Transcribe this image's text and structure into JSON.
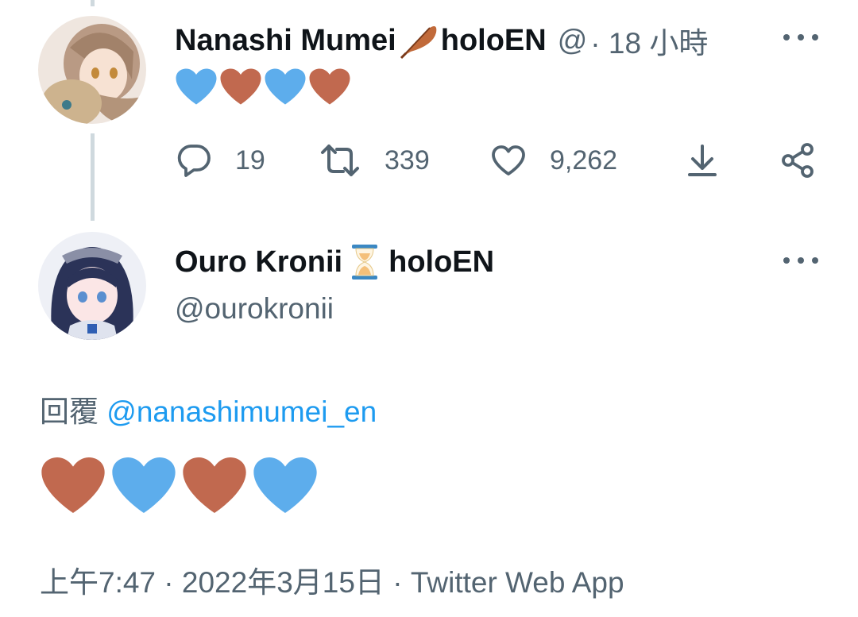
{
  "parent_tweet": {
    "display_name": "Nanashi Mumei",
    "name_suffix": "holoEN",
    "handle_truncated": "@",
    "time_ago": "· 18 小時",
    "emoji_icons": [
      "blue-heart-icon",
      "brown-heart-icon",
      "blue-heart-icon",
      "brown-heart-icon"
    ],
    "stats": {
      "replies": "19",
      "retweets": "339",
      "likes": "9,262"
    }
  },
  "main_tweet": {
    "display_name": "Ouro Kronii",
    "name_suffix": "holoEN",
    "handle": "@ourokronii",
    "reply_prefix": "回覆",
    "reply_to_handle": "@nanashimumei_en",
    "emoji_icons": [
      "brown-heart-icon",
      "blue-heart-icon",
      "brown-heart-icon",
      "blue-heart-icon"
    ],
    "timestamp": "上午7:47 · 2022年3月15日 · Twitter Web App"
  },
  "colors": {
    "blue_heart": "#5dadec",
    "brown_heart": "#c1694f",
    "link": "#1d9bf0",
    "secondary_text": "#536471"
  }
}
